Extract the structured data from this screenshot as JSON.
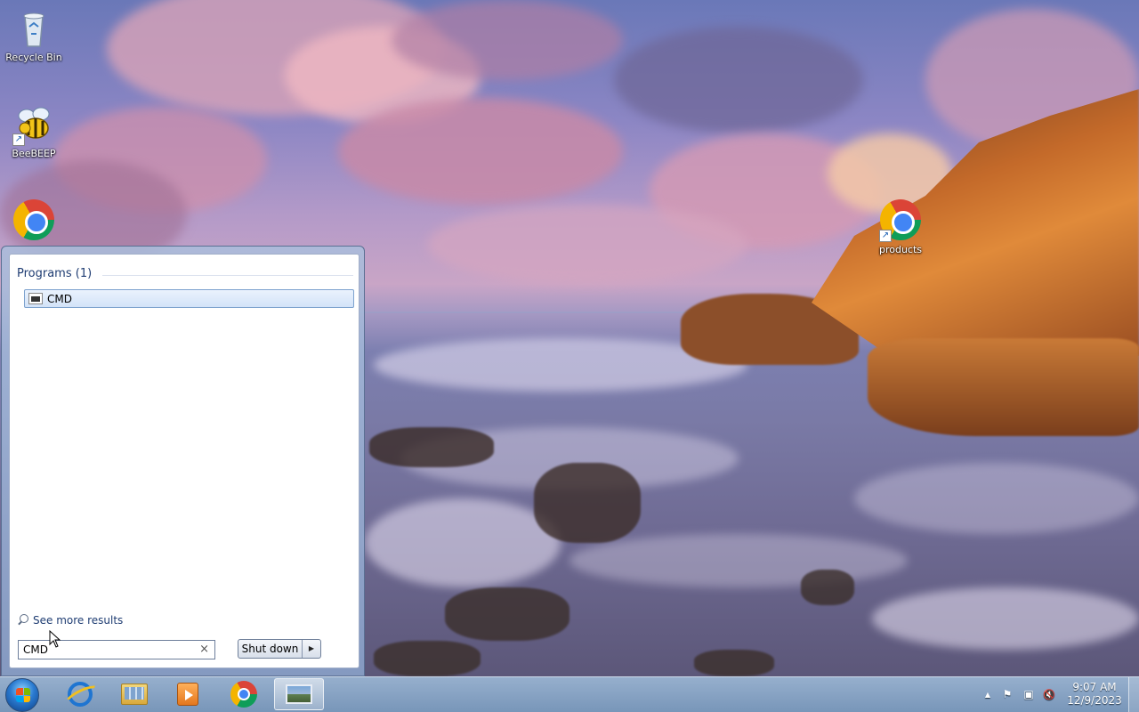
{
  "desktop": {
    "icons": [
      {
        "label": "Recycle Bin",
        "icon": "recycle-bin-icon"
      },
      {
        "label": "BeeBEEP",
        "icon": "bee-icon"
      },
      {
        "label": "",
        "icon": "chrome-icon"
      },
      {
        "label": "products",
        "icon": "chrome-icon"
      }
    ]
  },
  "start_menu": {
    "programs_header": "Programs (1)",
    "results": [
      {
        "label": "CMD",
        "icon": "cmd-icon"
      }
    ],
    "see_more": "See more results",
    "search": {
      "value": "CMD",
      "clear_glyph": "×"
    },
    "shutdown_label": "Shut down",
    "shutdown_arrow": "▶"
  },
  "taskbar": {
    "pinned": [
      {
        "name": "internet-explorer",
        "icon": "ie-icon"
      },
      {
        "name": "windows-explorer",
        "icon": "folder-icon"
      },
      {
        "name": "media-player",
        "icon": "media-player-icon"
      },
      {
        "name": "chrome",
        "icon": "chrome-icon"
      },
      {
        "name": "photo-viewer",
        "icon": "photo-icon",
        "active": true
      }
    ],
    "tray": {
      "show_hidden": "▲",
      "flag": "⚑",
      "network": "▣",
      "volume": "🔇"
    },
    "clock": {
      "time": "9:07 AM",
      "date": "12/9/2023"
    }
  },
  "colors": {
    "taskbar": "#96afcd",
    "start_menu_frame": "#aabedc",
    "selection": "#d3e3f8",
    "header_text": "#1e3c72"
  }
}
